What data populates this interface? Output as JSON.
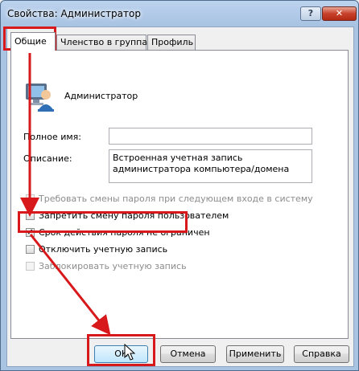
{
  "window": {
    "title": "Свойства: Администратор",
    "help_label": "?",
    "close_label": "✕"
  },
  "tabs": [
    {
      "label": "Общие",
      "active": true
    },
    {
      "label": "Членство в группах",
      "active": false
    },
    {
      "label": "Профиль",
      "active": false
    }
  ],
  "user": {
    "name": "Администратор",
    "icon": "user-icon"
  },
  "fields": {
    "fullname_label": "Полное имя:",
    "fullname_value": "",
    "description_label": "Описание:",
    "description_value": "Встроенная учетная запись администратора компьютера/домена"
  },
  "options": [
    {
      "label": "Требовать смены пароля при следующем входе в систему",
      "checked": false,
      "enabled": false
    },
    {
      "label": "Запретить смену пароля пользователем",
      "checked": false,
      "enabled": true
    },
    {
      "label": "Срок действия пароля не ограничен",
      "checked": true,
      "enabled": true
    },
    {
      "label": "Отключить учетную запись",
      "checked": false,
      "enabled": true
    },
    {
      "label": "Заблокировать учетную запись",
      "checked": false,
      "enabled": false
    }
  ],
  "buttons": {
    "ok": "ОК",
    "cancel": "Отмена",
    "apply": "Применить",
    "help": "Справка"
  },
  "annotation_color": "#d7191c"
}
